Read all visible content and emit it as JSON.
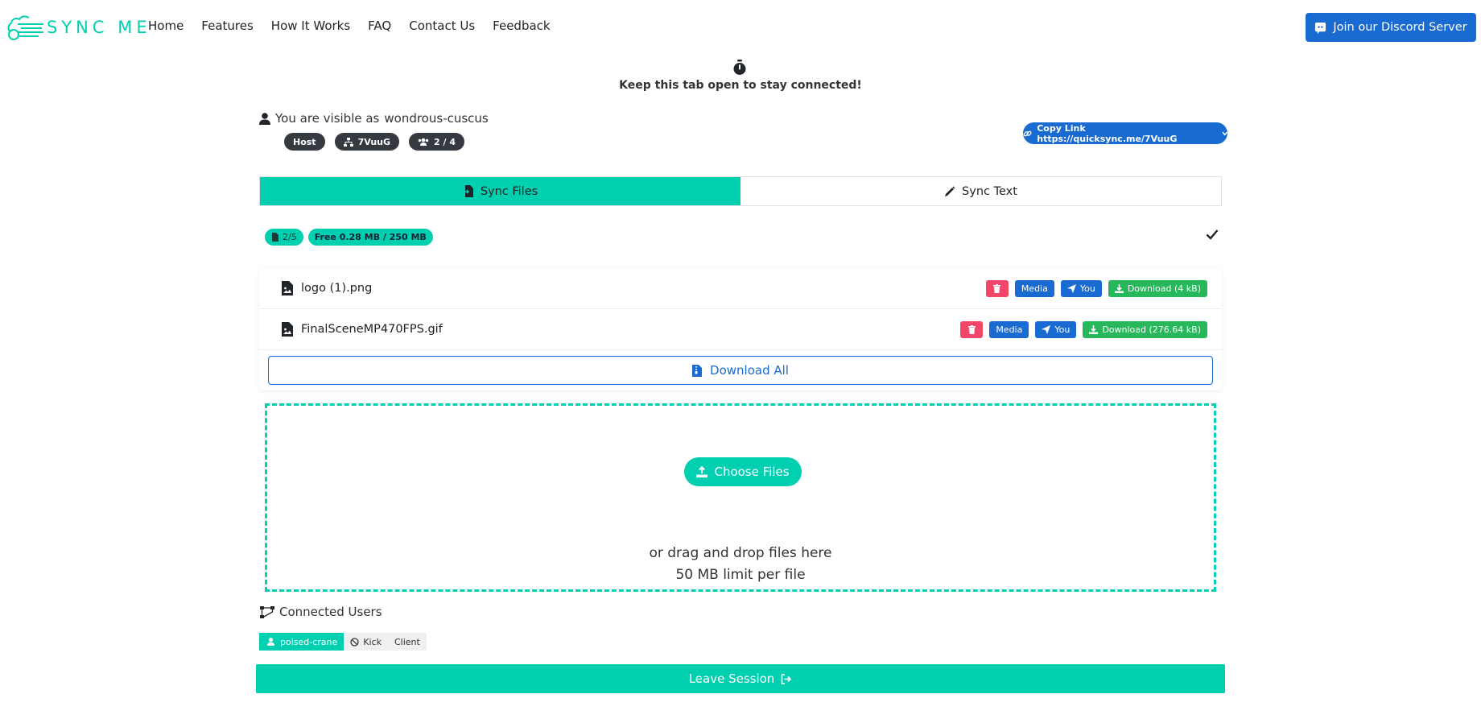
{
  "brand": {
    "name": "SYNC ME",
    "logo_icon": "cloud-logo-icon"
  },
  "nav": {
    "links": [
      "Home",
      "Features",
      "How It Works",
      "FAQ",
      "Contact Us",
      "Feedback"
    ],
    "discord_label": "Join our Discord Server"
  },
  "notice": {
    "text": "Keep this tab open to stay connected!"
  },
  "session": {
    "visible_prefix": "You are visible as",
    "username": "wondrous-cuscus",
    "role_badge": "Host",
    "code_badge": "7VuuG",
    "users_badge": "2 / 4",
    "copy_link_label": "Copy Link https://quicksync.me/7VuuG"
  },
  "tabs": {
    "files": "Sync Files",
    "text": "Sync Text"
  },
  "status": {
    "file_count": "2/5",
    "storage": "Free 0.28 MB / 250 MB"
  },
  "files": [
    {
      "name": "logo (1).png",
      "media_label": "Media",
      "sender_label": "You",
      "download_label": "Download (4 kB)"
    },
    {
      "name": "FinalSceneMP470FPS.gif",
      "media_label": "Media",
      "sender_label": "You",
      "download_label": "Download (276.64 kB)"
    }
  ],
  "download_all_label": "Download All",
  "dropzone": {
    "choose_label": "Choose Files",
    "drag_text": "or drag and drop files here",
    "limit_text": "50 MB limit per file"
  },
  "connected": {
    "title": "Connected Users",
    "user": "poised-crane",
    "kick_label": "Kick",
    "role_label": "Client"
  },
  "leave_label": "Leave Session",
  "colors": {
    "accent": "#00cfb0",
    "primary": "#1a6bd1",
    "danger": "#f2456a",
    "success": "#26b85a",
    "dark": "#343a40"
  }
}
